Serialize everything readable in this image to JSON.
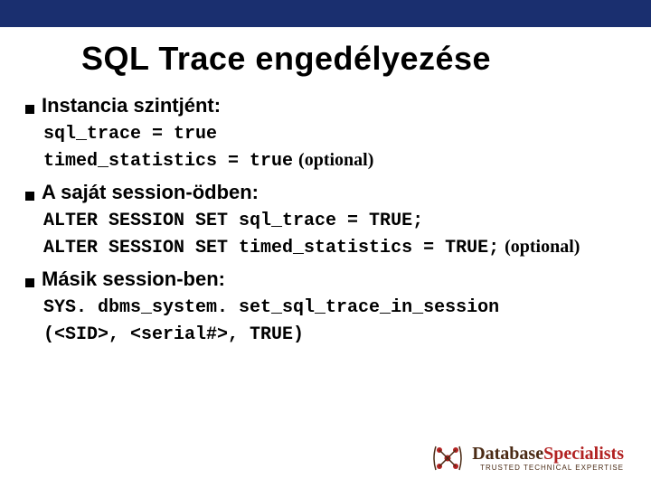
{
  "title": "SQL Trace engedélyezése",
  "sections": [
    {
      "label": "Instancia szintjént:",
      "lines": [
        {
          "code": "sql_trace = true",
          "optional": ""
        },
        {
          "code": "timed_statistics = true",
          "optional": "(optional)"
        }
      ]
    },
    {
      "label": "A saját session-ödben:",
      "lines": [
        {
          "code": "ALTER SESSION SET sql_trace = TRUE;",
          "optional": ""
        },
        {
          "code": "ALTER SESSION SET timed_statistics = TRUE;",
          "optional": "(optional)"
        }
      ]
    },
    {
      "label": "Másik session-ben:",
      "lines": [
        {
          "code": "SYS. dbms_system. set_sql_trace_in_session",
          "optional": ""
        },
        {
          "code": "(<SID>, <serial#>, TRUE)",
          "optional": ""
        }
      ]
    }
  ],
  "logo": {
    "word1": "Database",
    "word2": "Specialists",
    "subtitle": "TRUSTED TECHNICAL EXPERTISE"
  }
}
